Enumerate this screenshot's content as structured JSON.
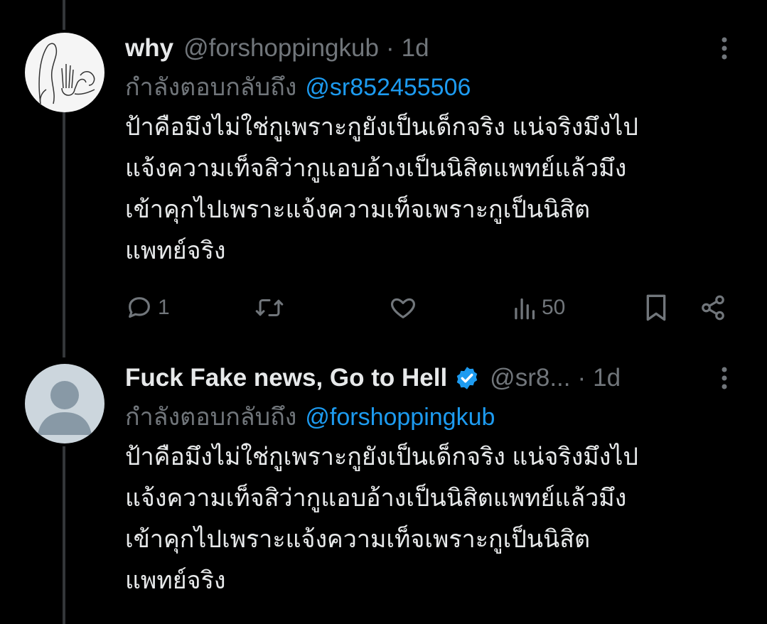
{
  "tweets": [
    {
      "name": "why",
      "handle": "@forshoppingkub",
      "dot": "·",
      "time": "1d",
      "reply_prefix": "กำลังตอบกลับถึง",
      "reply_mention": "@sr852455506",
      "text": "ป้าคือมึงไม่ใช่กูเพราะกูยังเป็นเด็กจริง แน่จริงมึงไป\nแจ้งความเท็จสิว่ากูแอบอ้างเป็นนิสิตแพทย์แล้วมึง\nเข้าคุกไปเพราะแจ้งความเท็จเพราะกูเป็นนิสิต\nแพทย์จริง",
      "actions": {
        "reply_count": "1",
        "retweet_count": "",
        "like_count": "",
        "views_count": "50"
      }
    },
    {
      "name": "Fuck Fake news, Go to Hell",
      "verified": true,
      "handle": "@sr8...",
      "dot": "·",
      "time": "1d",
      "reply_prefix": "กำลังตอบกลับถึง",
      "reply_mention": "@forshoppingkub",
      "text": "ป้าคือมึงไม่ใช่กูเพราะกูยังเป็นเด็กจริง แน่จริงมึงไป\nแจ้งความเท็จสิว่ากูแอบอ้างเป็นนิสิตแพทย์แล้วมึง\nเข้าคุกไปเพราะแจ้งความเท็จเพราะกูเป็นนิสิต\nแพทย์จริง"
    }
  ],
  "colors": {
    "background": "#000000",
    "text": "#e7e9ea",
    "muted": "#71767b",
    "accent": "#1d9bf0",
    "thread_line": "#333639"
  },
  "icons": [
    "more-icon",
    "reply-icon",
    "retweet-icon",
    "like-icon",
    "views-icon",
    "bookmark-icon",
    "share-icon",
    "verified-badge-icon"
  ]
}
